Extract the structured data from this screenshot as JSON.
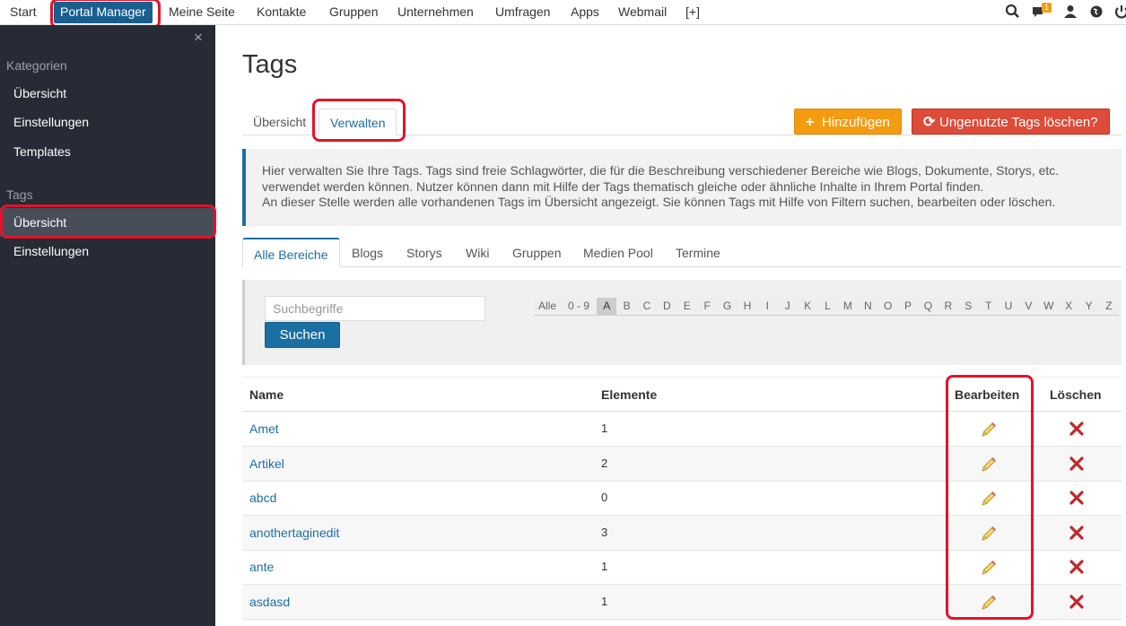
{
  "topnav": {
    "items": [
      "Start",
      "Portal Manager",
      "Meine Seite",
      "Kontakte",
      "Gruppen",
      "Unternehmen",
      "Umfragen",
      "Apps",
      "Webmail",
      "[+]"
    ],
    "notification_count": "1"
  },
  "sidebar": {
    "close": "×",
    "section1": "Kategorien",
    "section1_items": [
      "Übersicht",
      "Einstellungen",
      "Templates"
    ],
    "section2": "Tags",
    "section2_items": [
      "Übersicht",
      "Einstellungen"
    ]
  },
  "page": {
    "title": "Tags",
    "tabs": [
      "Übersicht",
      "Verwalten"
    ],
    "add_button": "Hinzufügen",
    "delete_unused_button": "Ungenutzte Tags löschen?",
    "info_lines": [
      "Hier verwalten Sie Ihre Tags. Tags sind freie Schlagwörter, die für die Beschreibung verschiedener Bereiche wie Blogs, Dokumente, Storys, etc.",
      "verwendet werden können. Nutzer können dann mit Hilfe der Tags thematisch gleiche oder ähnliche Inhalte in Ihrem Portal finden.",
      "An dieser Stelle werden alle vorhandenen Tags im Übersicht angezeigt. Sie können Tags mit Hilfe von Filtern suchen, bearbeiten oder löschen."
    ]
  },
  "area_tabs": [
    "Alle Bereiche",
    "Blogs",
    "Storys",
    "Wiki",
    "Gruppen",
    "Medien Pool",
    "Termine"
  ],
  "filter": {
    "placeholder": "Suchbegriffe",
    "search_button": "Suchen",
    "letters": [
      "Alle",
      "0 - 9",
      "A",
      "B",
      "C",
      "D",
      "E",
      "F",
      "G",
      "H",
      "I",
      "J",
      "K",
      "L",
      "M",
      "N",
      "O",
      "P",
      "Q",
      "R",
      "S",
      "T",
      "U",
      "V",
      "W",
      "X",
      "Y",
      "Z"
    ],
    "selected": "A"
  },
  "table": {
    "headers": {
      "name": "Name",
      "elements": "Elemente",
      "edit": "Bearbeiten",
      "delete": "Löschen"
    },
    "rows": [
      {
        "name": "Amet",
        "count": "1"
      },
      {
        "name": "Artikel",
        "count": "2"
      },
      {
        "name": "abcd",
        "count": "0"
      },
      {
        "name": "anothertaginedit",
        "count": "3"
      },
      {
        "name": "ante",
        "count": "1"
      },
      {
        "name": "asdasd",
        "count": "1"
      }
    ]
  }
}
